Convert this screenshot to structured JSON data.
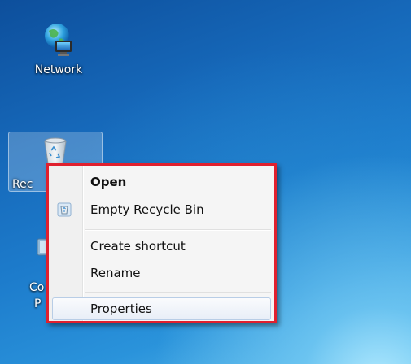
{
  "desktop": {
    "icons": [
      {
        "label": "Network",
        "icon": "network-globe-icon"
      },
      {
        "label": "Recycle Bin",
        "visible_label": "Rec",
        "icon": "recycle-bin-icon",
        "selected": true
      },
      {
        "label_line1": "Co",
        "label_line2": "P",
        "icon": "control-panel-icon"
      }
    ]
  },
  "context_menu": {
    "items": [
      {
        "label": "Open",
        "bold": true
      },
      {
        "label": "Empty Recycle Bin",
        "icon": "recycle-bin-small-icon"
      },
      {
        "label": "Create shortcut"
      },
      {
        "label": "Rename"
      },
      {
        "label": "Properties",
        "highlighted": true
      }
    ],
    "highlight_color": "#e0202e"
  }
}
